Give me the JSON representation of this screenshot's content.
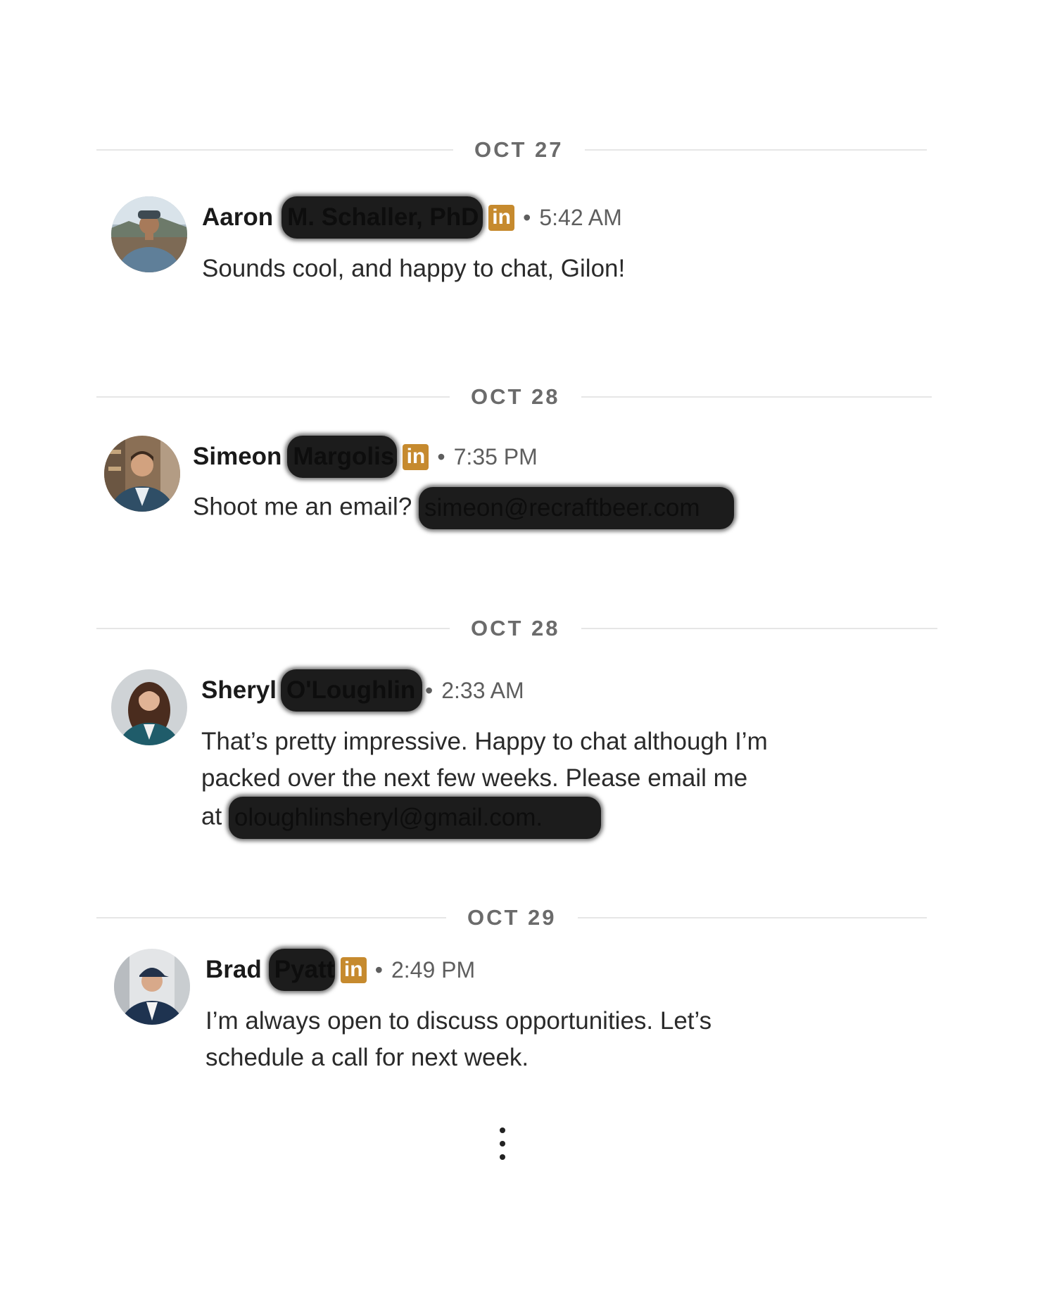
{
  "conversations": [
    {
      "date": "OCT 27",
      "first_name": "Aaron",
      "redacted_name": "M. Schaller, PhD",
      "linkedin_badge": "in",
      "separator": "•",
      "time": "5:42 AM",
      "body": "Sounds cool, and happy to chat, Gilon!",
      "avatar_icon": "profile-photo-man-cap"
    },
    {
      "date": "OCT 28",
      "first_name": "Simeon",
      "redacted_name": "Margolis",
      "linkedin_badge": "in",
      "separator": "•",
      "time": "7:35 PM",
      "body_prefix": "Shoot me an email? ",
      "redacted_email": "simeon@recraftbeer.com",
      "avatar_icon": "profile-photo-man-suit"
    },
    {
      "date": "OCT 28",
      "first_name": "Sheryl",
      "redacted_name": "O'Loughlin",
      "separator": "•",
      "time": "2:33 AM",
      "body_line1": "That’s pretty impressive. Happy to chat although I’m",
      "body_line2": "packed over the next few weeks. Please email me",
      "body_line3_prefix": "at ",
      "redacted_email": "oloughlinsheryl@gmail.com.",
      "avatar_icon": "profile-photo-woman-blazer"
    },
    {
      "date": "OCT 29",
      "first_name": "Brad",
      "redacted_name": "Pyatt",
      "linkedin_badge": "in",
      "separator": "•",
      "time": "2:49 PM",
      "body_line1": "I’m always open to discuss opportunities. Let’s",
      "body_line2": "schedule a call for next week.",
      "avatar_icon": "profile-photo-man-cap-suit"
    }
  ],
  "more_icon": "vertical-ellipsis-icon",
  "colors": {
    "linkedin_badge": "#c68a2e",
    "divider": "#e6e6e6",
    "date_label": "#6b6b6b",
    "redaction": "#1c1c1c"
  }
}
